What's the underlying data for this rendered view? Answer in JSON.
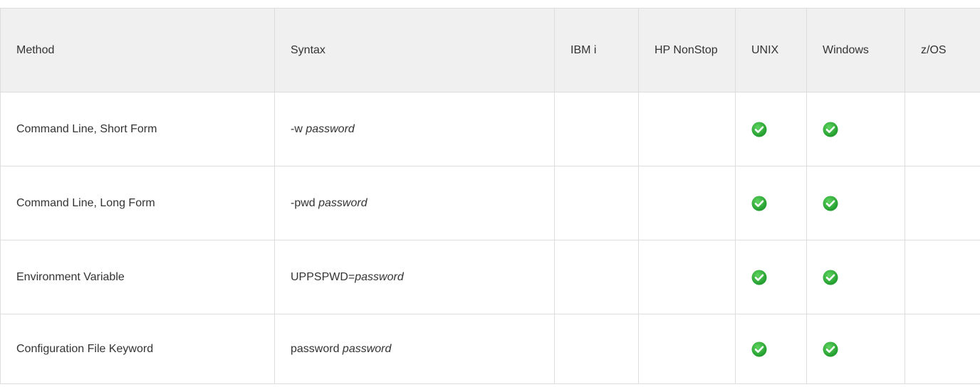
{
  "table": {
    "headers": {
      "method": "Method",
      "syntax": "Syntax",
      "ibmi": "IBM i",
      "hp_nonstop": "HP NonStop",
      "unix": "UNIX",
      "windows": "Windows",
      "zos": "z/OS"
    },
    "rows": [
      {
        "method": "Command Line, Short Form",
        "syntax_prefix": "-w ",
        "syntax_arg": "password",
        "ibmi": false,
        "hp_nonstop": false,
        "unix": true,
        "windows": true,
        "zos": false
      },
      {
        "method": "Command Line, Long Form",
        "syntax_prefix": "-pwd ",
        "syntax_arg": "password",
        "ibmi": false,
        "hp_nonstop": false,
        "unix": true,
        "windows": true,
        "zos": false
      },
      {
        "method": "Environment Variable",
        "syntax_prefix": "UPPSPWD=",
        "syntax_arg": "password",
        "ibmi": false,
        "hp_nonstop": false,
        "unix": true,
        "windows": true,
        "zos": false
      },
      {
        "method": "Configuration File Keyword",
        "syntax_prefix": "password ",
        "syntax_arg": "password",
        "ibmi": false,
        "hp_nonstop": false,
        "unix": true,
        "windows": true,
        "zos": false
      }
    ]
  },
  "icons": {
    "supported": "check-icon"
  },
  "colors": {
    "check_green_light": "#5fd45f",
    "check_green_dark": "#1f9a2c",
    "header_bg": "#f0f0f0",
    "border": "#dddddd"
  }
}
